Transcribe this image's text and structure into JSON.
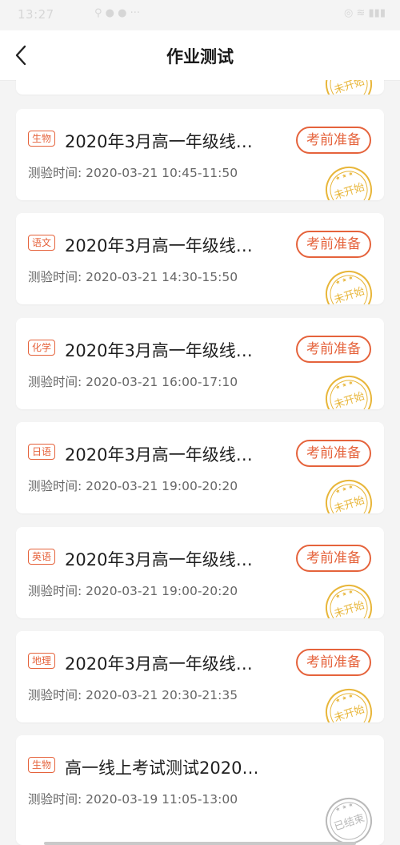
{
  "status_bar": {
    "time": "13:27",
    "signal_text": "ᵢₗ",
    "right_icons": "◎ ≋ ▮▮▮",
    "dots": "⚲ ● ● ···"
  },
  "nav": {
    "title": "作业测试",
    "back_icon": "chevron-left-icon"
  },
  "colors": {
    "accent": "#e5633c",
    "stamp_pending": "#e8b63a",
    "stamp_ended": "#b9b9b9"
  },
  "common": {
    "prep_button_label": "考前准备"
  },
  "partial_card": {
    "stamp_label": "未开始"
  },
  "cards": [
    {
      "subject": "生物",
      "title": "2020年3月高一年级线…",
      "time": "测验时间: 2020-03-21 10:45-11:50",
      "stamp": "未开始"
    },
    {
      "subject": "语文",
      "title": "2020年3月高一年级线…",
      "time": "测验时间: 2020-03-21 14:30-15:50",
      "stamp": "未开始"
    },
    {
      "subject": "化学",
      "title": "2020年3月高一年级线…",
      "time": "测验时间: 2020-03-21 16:00-17:10",
      "stamp": "未开始"
    },
    {
      "subject": "日语",
      "title": "2020年3月高一年级线…",
      "time": "测验时间: 2020-03-21 19:00-20:20",
      "stamp": "未开始"
    },
    {
      "subject": "英语",
      "title": "2020年3月高一年级线…",
      "time": "测验时间: 2020-03-21 19:00-20:20",
      "stamp": "未开始"
    },
    {
      "subject": "地理",
      "title": "2020年3月高一年级线…",
      "time": "测验时间: 2020-03-21 20:30-21:35",
      "stamp": "未开始"
    },
    {
      "subject": "生物",
      "title": "高一线上考试测试2020…",
      "time": "测验时间: 2020-03-19 11:05-13:00",
      "stamp": "已结束"
    }
  ]
}
